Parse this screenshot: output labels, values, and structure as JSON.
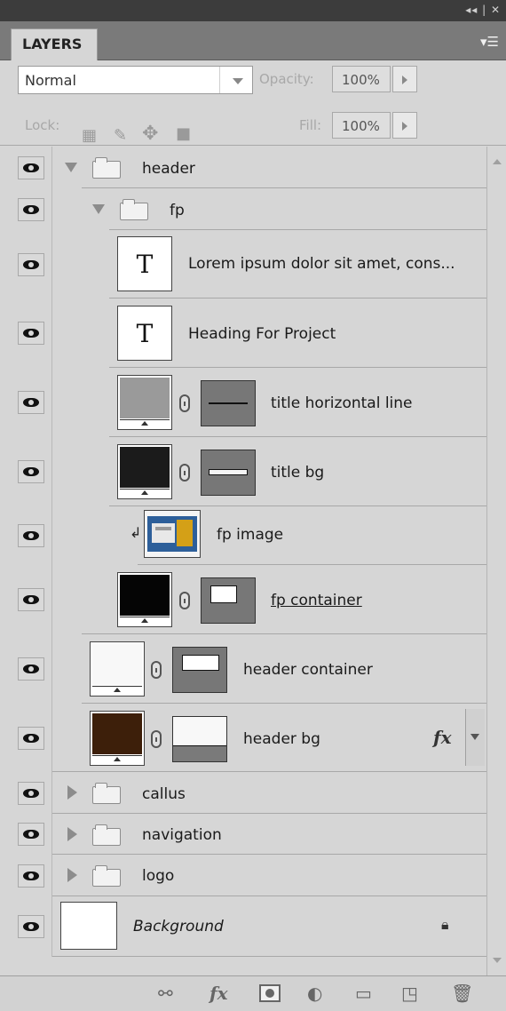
{
  "window": {
    "controls": "◂◂ | ✕"
  },
  "panel": {
    "tab": "LAYERS",
    "menu_icon": "panel-menu-icon"
  },
  "controls": {
    "blend_mode": "Normal",
    "opacity_label": "Opacity:",
    "opacity_value": "100%",
    "lock_label": "Lock:",
    "fill_label": "Fill:",
    "fill_value": "100%"
  },
  "layers": [
    {
      "name": "header",
      "type": "group",
      "expanded": true
    },
    {
      "name": "fp",
      "type": "group",
      "expanded": true
    },
    {
      "name": "Lorem ipsum dolor sit amet, cons...",
      "type": "text"
    },
    {
      "name": "Heading For Project",
      "type": "text"
    },
    {
      "name": "title horizontal line",
      "type": "masked",
      "thumb_color": "#9a9a9a"
    },
    {
      "name": "title bg",
      "type": "masked",
      "thumb_color": "#1b1b1b"
    },
    {
      "name": "fp image",
      "type": "clipped-image"
    },
    {
      "name": "fp container",
      "type": "masked",
      "thumb_color": "#050505",
      "underline": true
    },
    {
      "name": "header container",
      "type": "masked",
      "thumb_color": "#f8f8f8"
    },
    {
      "name": "header bg",
      "type": "masked",
      "thumb_color": "#3d1f0a",
      "has_fx": true
    },
    {
      "name": "callus",
      "type": "group",
      "expanded": false
    },
    {
      "name": "navigation",
      "type": "group",
      "expanded": false
    },
    {
      "name": "logo",
      "type": "group",
      "expanded": false
    },
    {
      "name": "Background",
      "type": "background",
      "locked": true
    }
  ],
  "fx_label": "fx",
  "bottom_icons": [
    "link-layers-icon",
    "fx-icon",
    "add-mask-icon",
    "adjustment-layer-icon",
    "new-group-icon",
    "new-layer-icon",
    "trash-icon"
  ]
}
